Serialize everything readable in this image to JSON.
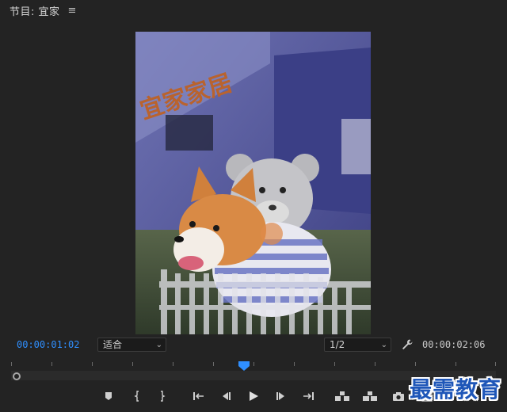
{
  "panel": {
    "title": "节目: 宜家",
    "menu_icon": "hamburger-menu-icon"
  },
  "viewer": {
    "sign_text": "宜家家居",
    "scene": "corgi-dog-and-teddy-bear-overlay-on-ikea-building"
  },
  "timecode": {
    "current": "00:00:01:02",
    "duration": "00:00:02:06",
    "current_color": "#2f8fff"
  },
  "zoom": {
    "selected": "适合"
  },
  "resolution": {
    "selected": "1/2"
  },
  "transport": {
    "buttons": [
      {
        "name": "add-marker-icon"
      },
      {
        "name": "mark-in-icon"
      },
      {
        "name": "mark-out-icon"
      },
      {
        "name": "go-to-in-icon"
      },
      {
        "name": "step-back-icon"
      },
      {
        "name": "play-icon"
      },
      {
        "name": "step-forward-icon"
      },
      {
        "name": "go-to-out-icon"
      },
      {
        "name": "lift-icon"
      },
      {
        "name": "extract-icon"
      },
      {
        "name": "export-frame-icon"
      },
      {
        "name": "button-editor-icon"
      }
    ]
  },
  "watermark": {
    "text": "最需教育",
    "color": "#1e56b8"
  }
}
